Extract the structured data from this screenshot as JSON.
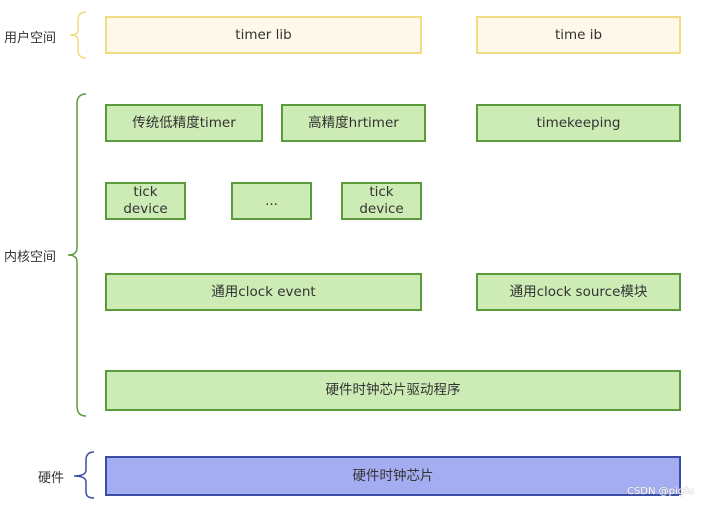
{
  "sections": {
    "user": "用户空间",
    "kernel": "内核空间",
    "hardware": "硬件"
  },
  "boxes": {
    "timer_lib": "timer lib",
    "time_ib": "time ib",
    "low_res_timer": "传统低精度timer",
    "hrtimer": "高精度hrtimer",
    "timekeeping": "timekeeping",
    "tick_device_1": "tick device",
    "ellipsis": "...",
    "tick_device_2": "tick device",
    "clock_event": "通用clock event",
    "clock_source": "通用clock source模块",
    "driver": "硬件时钟芯片驱动程序",
    "chip": "硬件时钟芯片"
  },
  "watermark": "CSDN @pigfu",
  "colors": {
    "user": "#f0dc82",
    "kernel": "#5b9b3c",
    "hardware": "#3b4ea4"
  }
}
